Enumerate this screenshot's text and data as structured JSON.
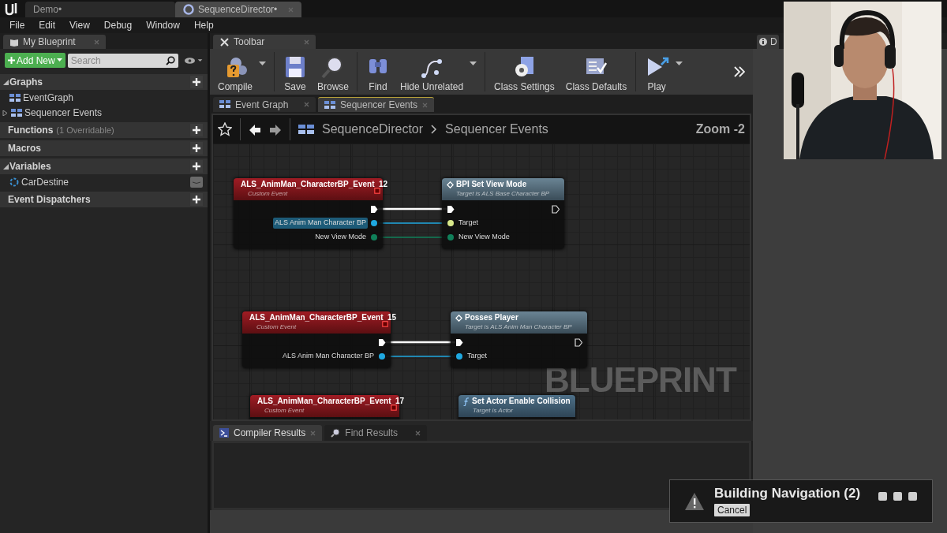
{
  "app_tabs": [
    {
      "label": "Demo•",
      "selected": false
    },
    {
      "label": "SequenceDirector•",
      "selected": true
    }
  ],
  "menu": [
    "File",
    "Edit",
    "View",
    "Debug",
    "Window",
    "Help"
  ],
  "my_blueprint": {
    "tab": "My Blueprint",
    "add_button": "Add New",
    "search": {
      "placeholder": "Search"
    },
    "sections": [
      {
        "title": "Graphs",
        "expanded": true,
        "items": [
          {
            "label": "EventGraph",
            "kind": "graph"
          },
          {
            "label": "Sequencer Events",
            "kind": "graph",
            "expanded": false
          }
        ]
      },
      {
        "title": "Functions",
        "note": "(1 Overridable)"
      },
      {
        "title": "Macros"
      },
      {
        "title": "Variables",
        "expanded": true,
        "items": [
          {
            "label": "CarDestine",
            "kind": "variable"
          }
        ]
      },
      {
        "title": "Event Dispatchers"
      }
    ]
  },
  "toolbar": {
    "tab": "Toolbar",
    "buttons": [
      {
        "label": "Compile",
        "kind": "compile",
        "dropdown": true,
        "separator_after": true
      },
      {
        "label": "Save",
        "kind": "save"
      },
      {
        "label": "Browse",
        "kind": "browse",
        "separator_after": true
      },
      {
        "label": "Find",
        "kind": "find"
      },
      {
        "label": "Hide Unrelated",
        "kind": "hide",
        "dropdown": true,
        "separator_after": true
      },
      {
        "label": "Class Settings",
        "kind": "settings"
      },
      {
        "label": "Class Defaults",
        "kind": "defaults",
        "separator_after": true
      },
      {
        "label": "Play",
        "kind": "play",
        "dropdown": true
      }
    ]
  },
  "graph_tabs": [
    {
      "label": "Event Graph",
      "selected": false
    },
    {
      "label": "Sequencer Events",
      "selected": true
    }
  ],
  "graph": {
    "breadcrumb": [
      "SequenceDirector",
      "Sequencer Events"
    ],
    "zoom": "Zoom -2",
    "watermark": "BLUEPRINT",
    "nodes": [
      {
        "kind": "event",
        "title": "ALS_AnimMan_CharacterBP_Event_12",
        "subtitle": "Custom Event",
        "outputs": [
          {
            "kind": "exec",
            "connected": true
          },
          {
            "kind": "data",
            "label": "ALS Anim Man Character BP",
            "color": "#1fa8e0",
            "connected": true,
            "highlighted": true
          },
          {
            "kind": "data",
            "label": "New View Mode",
            "color": "#10805a",
            "connected": true,
            "highlighted": false
          }
        ]
      },
      {
        "kind": "function",
        "title": "BPI Set View Mode",
        "subtitle": "Target is ALS Base Character BP",
        "inputs": [
          {
            "kind": "exec",
            "connected": true
          },
          {
            "kind": "data",
            "label": "Target",
            "color": "#d8e88a",
            "connected": true,
            "highlighted": false
          },
          {
            "kind": "data",
            "label": "New View Mode",
            "color": "#10805a",
            "connected": true,
            "highlighted": false
          }
        ],
        "outputs": [
          {
            "kind": "exec",
            "connected": false
          }
        ]
      },
      {
        "kind": "event",
        "title": "ALS_AnimMan_CharacterBP_Event_15",
        "subtitle": "Custom Event",
        "outputs": [
          {
            "kind": "exec",
            "connected": true
          },
          {
            "kind": "data",
            "label": "ALS Anim Man Character BP",
            "color": "#1fa8e0",
            "connected": true,
            "highlighted": false
          }
        ]
      },
      {
        "kind": "function",
        "title": "Posses Player",
        "subtitle": "Target is ALS Anim Man Character BP",
        "inputs": [
          {
            "kind": "exec",
            "connected": true
          },
          {
            "kind": "data",
            "label": "Target",
            "color": "#1fa8e0",
            "connected": true,
            "highlighted": false
          }
        ],
        "outputs": [
          {
            "kind": "exec",
            "connected": false
          }
        ]
      },
      {
        "kind": "event",
        "title": "ALS_AnimMan_CharacterBP_Event_17",
        "subtitle": "Custom Event"
      },
      {
        "kind": "pure",
        "title": "Set Actor Enable Collision",
        "subtitle": "Target is Actor"
      }
    ]
  },
  "results_tabs": [
    {
      "label": "Compiler Results",
      "kind": "compiler",
      "selected": true
    },
    {
      "label": "Find Results",
      "kind": "find",
      "selected": false
    }
  ],
  "side_tab": {
    "label": "D"
  },
  "notification": {
    "title": "Building Navigation (2)",
    "button": "Cancel"
  }
}
